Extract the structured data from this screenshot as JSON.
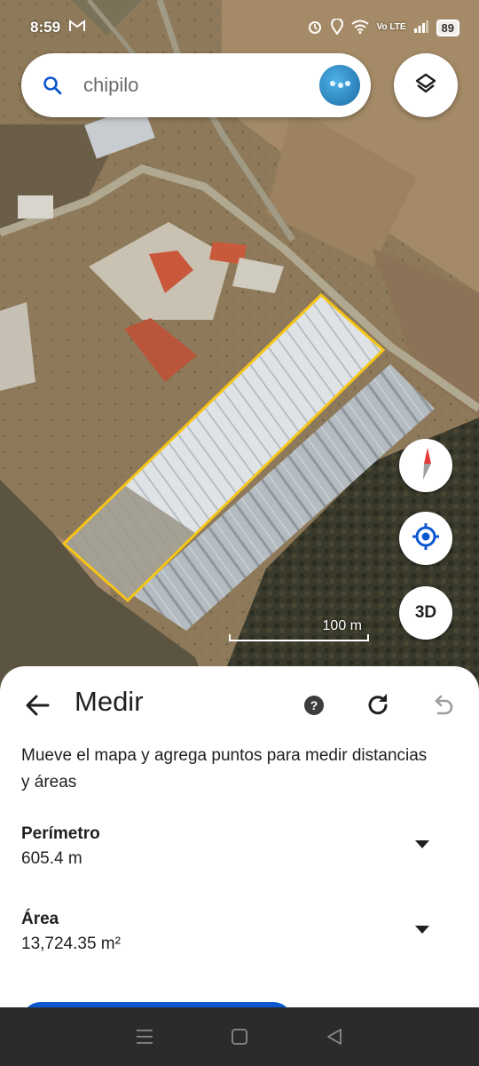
{
  "status_bar": {
    "time": "8:59",
    "gmail_icon": "gmail-icon",
    "network": "Vo LTE",
    "battery": "89"
  },
  "search": {
    "query": "chipilo",
    "icon": "search-icon",
    "avatar_icon": "profile-avatar"
  },
  "map": {
    "type": "satellite",
    "scale_label": "100 m",
    "measure_color": "#f5c518",
    "controls": {
      "layers_icon": "layers-icon",
      "compass_icon": "compass-icon",
      "location_icon": "my-location-icon",
      "view_3d_label": "3D"
    }
  },
  "sheet": {
    "title": "Medir",
    "back_icon": "arrow-back-icon",
    "help_icon": "help-icon",
    "reset_icon": "refresh-icon",
    "undo_icon": "undo-icon",
    "instructions": "Mueve el mapa y agrega puntos para medir distancias y áreas",
    "measurements": [
      {
        "label": "Perímetro",
        "value": "605.4 m"
      },
      {
        "label": "Área",
        "value": "13,724.35 m²"
      }
    ],
    "accent_color": "#0b57d0"
  },
  "nav_bar": {
    "items": [
      "menu-icon",
      "home-icon",
      "back-icon"
    ]
  }
}
